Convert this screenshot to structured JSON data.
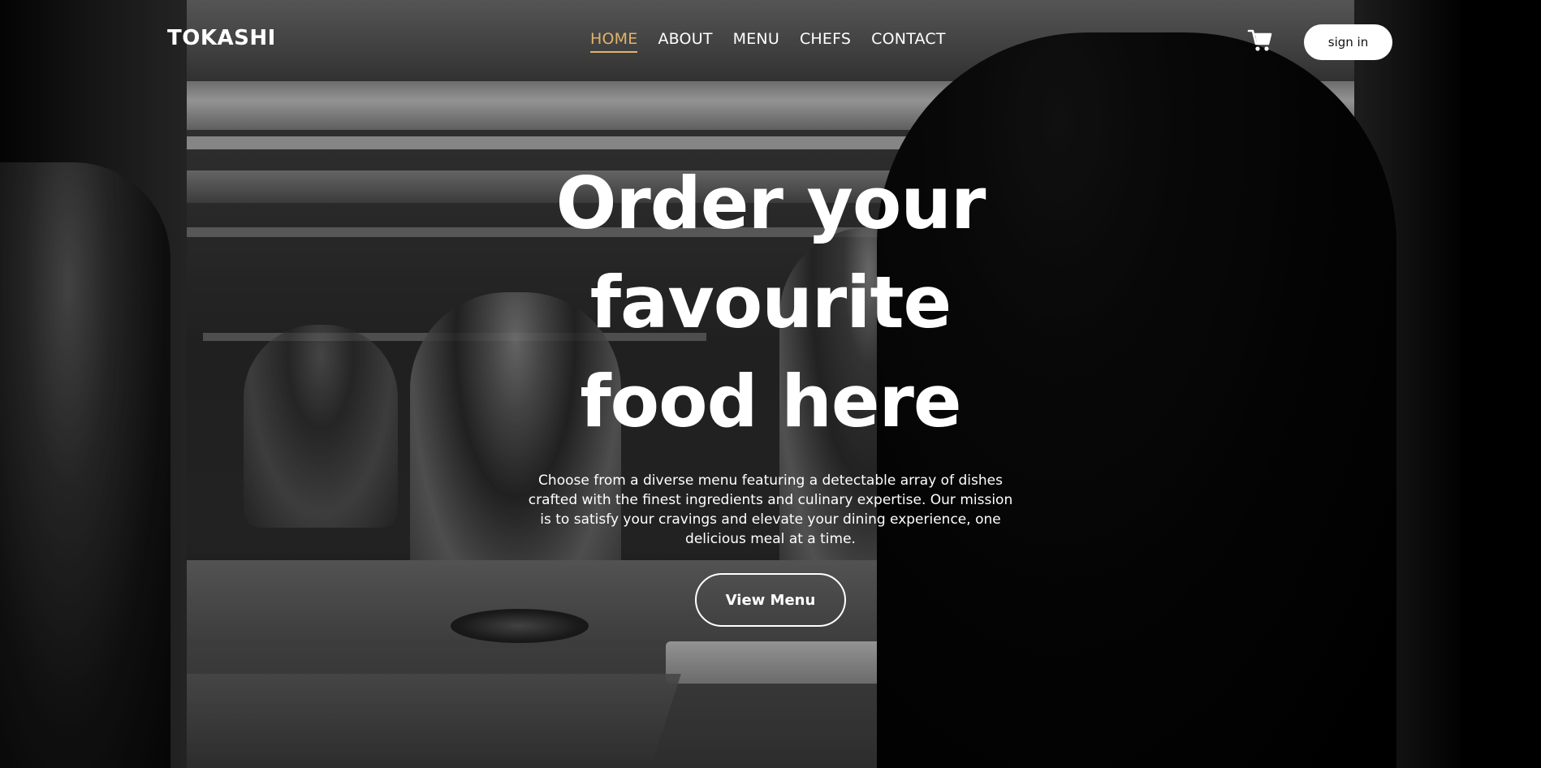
{
  "brand": {
    "name": "TOKASHI"
  },
  "nav": {
    "items": [
      {
        "label": "HOME",
        "active": true
      },
      {
        "label": "ABOUT",
        "active": false
      },
      {
        "label": "MENU",
        "active": false
      },
      {
        "label": "CHEFS",
        "active": false
      },
      {
        "label": "CONTACT",
        "active": false
      }
    ]
  },
  "header": {
    "cart_icon": "cart-icon",
    "signin_label": "sign in"
  },
  "hero": {
    "title_lines": [
      "Order your",
      "favourite",
      "food here"
    ],
    "description": "Choose from a diverse menu featuring a detectable array of dishes crafted with the finest ingredients and culinary expertise. Our mission is to satisfy your cravings and elevate your dining experience, one delicious meal at a time.",
    "cta_label": "View Menu"
  },
  "colors": {
    "accent": "#e0b46b",
    "text": "#ffffff",
    "button_bg": "#ffffff"
  }
}
